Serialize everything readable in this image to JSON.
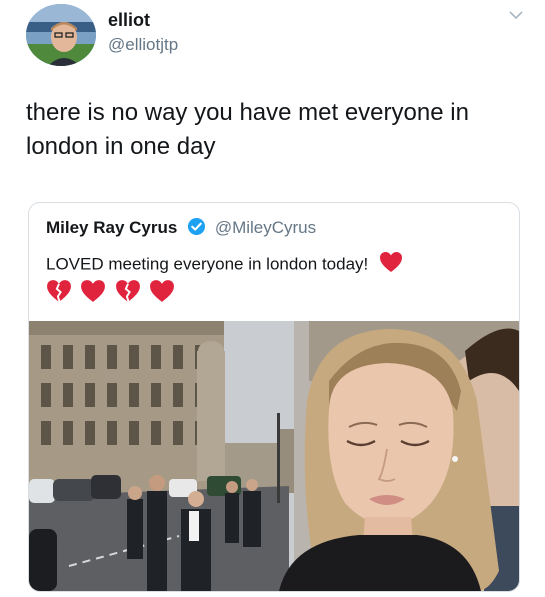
{
  "tweet": {
    "user": {
      "display_name": "elliot",
      "handle": "@elliotjtp"
    },
    "text": "there is no way you have met everyone in london in one day"
  },
  "quoted_tweet": {
    "user": {
      "display_name": "Miley Ray Cyrus",
      "handle": "@MileyCyrus",
      "verified": true
    },
    "text": "LOVED meeting everyone in london today!",
    "emoji": [
      "broken-heart",
      "red-heart",
      "broken-heart",
      "red-heart"
    ]
  },
  "icons": {
    "chevron": "chevron-down-icon",
    "verified": "verified-badge-icon",
    "heart": "red-heart-icon",
    "broken_heart": "broken-heart-icon"
  },
  "colors": {
    "text": "#14171a",
    "secondary_text": "#657786",
    "verified_blue": "#1da1f2",
    "heart_red": "#e0243d",
    "border": "#d9dee3"
  }
}
